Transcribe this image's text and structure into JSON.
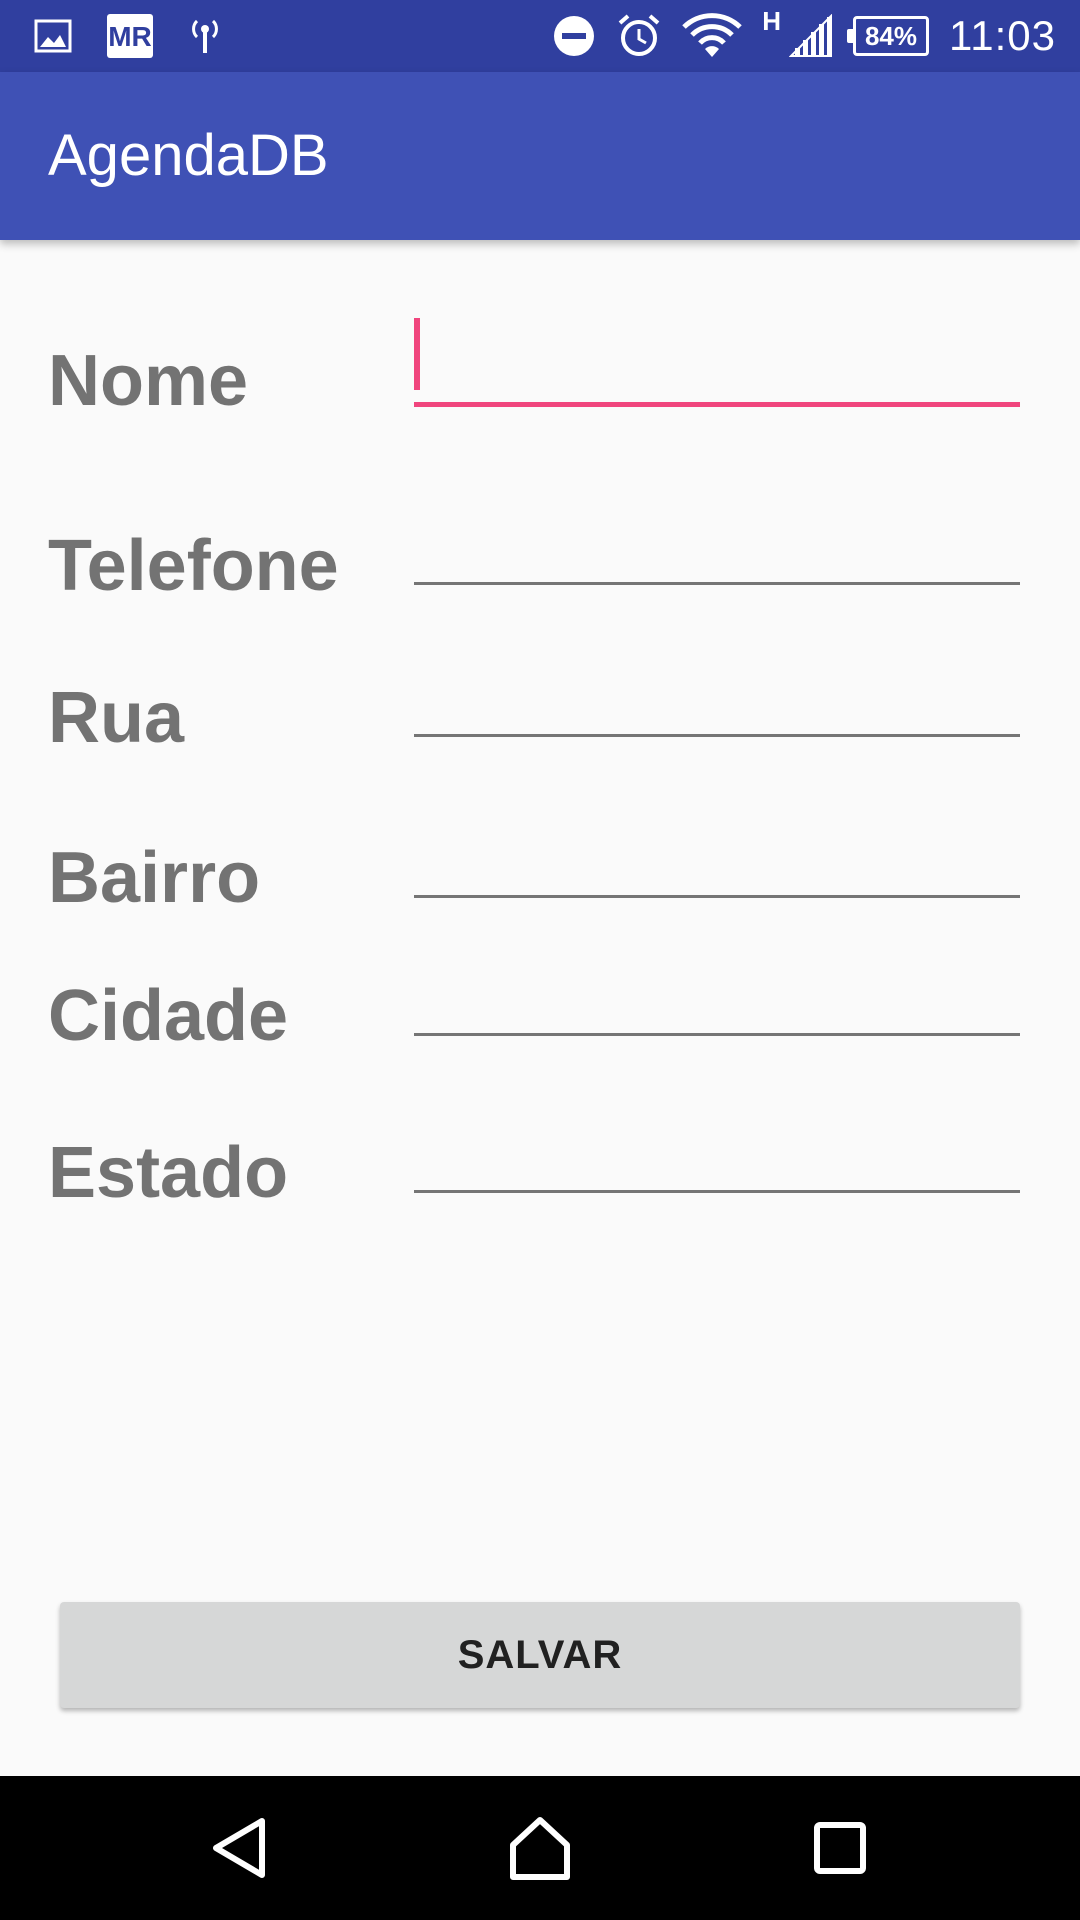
{
  "status_bar": {
    "time": "11:03",
    "battery": "84%",
    "network_type": "H",
    "left_icons": [
      "image-icon",
      "mr-app-icon",
      "antenna-icon"
    ],
    "right_icons": [
      "do-not-disturb-icon",
      "alarm-icon",
      "wifi-icon",
      "signal-icon",
      "battery-icon"
    ]
  },
  "app_bar": {
    "title": "AgendaDB"
  },
  "form": {
    "fields": [
      {
        "label": "Nome",
        "value": "",
        "focused": true
      },
      {
        "label": "Telefone",
        "value": ""
      },
      {
        "label": "Rua",
        "value": ""
      },
      {
        "label": "Bairro",
        "value": ""
      },
      {
        "label": "Cidade",
        "value": ""
      },
      {
        "label": "Estado",
        "value": ""
      }
    ],
    "save_label": "SALVAR"
  },
  "colors": {
    "status_bar": "#303f9f",
    "app_bar": "#3f51b5",
    "accent": "#f0457d",
    "label_text": "#737373",
    "button_bg": "#d6d7d7"
  },
  "nav_bar": {
    "icons": [
      "back-icon",
      "home-icon",
      "recents-icon"
    ]
  }
}
